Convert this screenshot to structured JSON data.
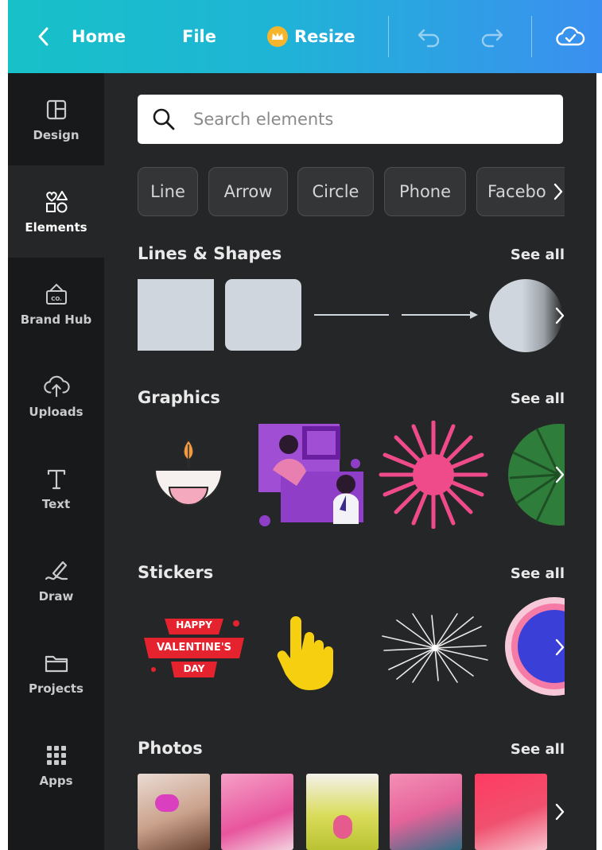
{
  "topbar": {
    "home_label": "Home",
    "file_label": "File",
    "resize_label": "Resize",
    "colors": {
      "gradient_start": "#17c1c8",
      "gradient_end": "#3b8ff0"
    }
  },
  "sidebar": {
    "items": [
      {
        "label": "Design",
        "icon": "layout-icon"
      },
      {
        "label": "Elements",
        "icon": "shapes-icon",
        "active": true
      },
      {
        "label": "Brand Hub",
        "icon": "brand-hub-icon"
      },
      {
        "label": "Uploads",
        "icon": "cloud-upload-icon"
      },
      {
        "label": "Text",
        "icon": "text-icon"
      },
      {
        "label": "Draw",
        "icon": "draw-icon"
      },
      {
        "label": "Projects",
        "icon": "folder-icon"
      },
      {
        "label": "Apps",
        "icon": "apps-grid-icon"
      }
    ]
  },
  "search": {
    "placeholder": "Search elements"
  },
  "chips": [
    "Line",
    "Arrow",
    "Circle",
    "Phone",
    "Facebo"
  ],
  "sections": [
    {
      "title": "Lines & Shapes",
      "see_all": "See all"
    },
    {
      "title": "Graphics",
      "see_all": "See all"
    },
    {
      "title": "Stickers",
      "see_all": "See all"
    },
    {
      "title": "Photos",
      "see_all": "See all"
    }
  ],
  "stickers": {
    "valentine_lines": [
      "HAPPY",
      "VALENTINE'S",
      "DAY"
    ]
  },
  "colors": {
    "panel_bg": "#252627",
    "rail_bg": "#18191b",
    "shape_fill": "#cfd6dd"
  }
}
